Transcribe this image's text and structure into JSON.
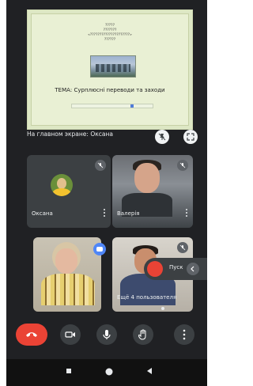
{
  "presentation": {
    "slide_heading_lines": [
      "?????",
      "???????",
      "«?????????????????????»",
      "??????"
    ],
    "slide_topic": "ТЕМА: Сурплюсні переводи та заходи",
    "caption": "На главном экране: Оксана"
  },
  "participants": [
    {
      "name": "Оксана",
      "type": "avatar",
      "muted": true
    },
    {
      "name": "Валерія",
      "type": "camera",
      "muted": true
    },
    {
      "name": "",
      "type": "camera",
      "muted": false,
      "hand_raised": true
    },
    {
      "name": "Ещё 4 пользователя",
      "type": "camera",
      "muted": true
    }
  ],
  "recording": {
    "label": "Пуск"
  },
  "colors": {
    "end_call": "#ea4335",
    "background": "#202124",
    "tile": "#3c4043",
    "raise_hand": "#4f86f7"
  }
}
